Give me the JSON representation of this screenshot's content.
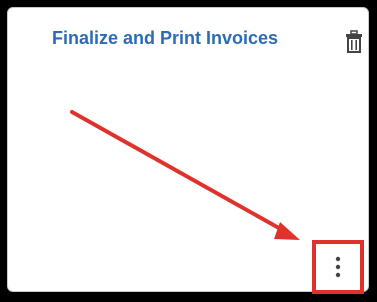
{
  "tile": {
    "title": "Finalize and Print Invoices",
    "delete_icon": "trash-icon",
    "menu_icon": "vertical-ellipsis-icon"
  },
  "annotation": {
    "arrow_color": "#e0322d",
    "highlight_color": "#e0322d"
  },
  "colors": {
    "title": "#2b6cb5",
    "background": "#000000",
    "tile": "#ffffff"
  }
}
